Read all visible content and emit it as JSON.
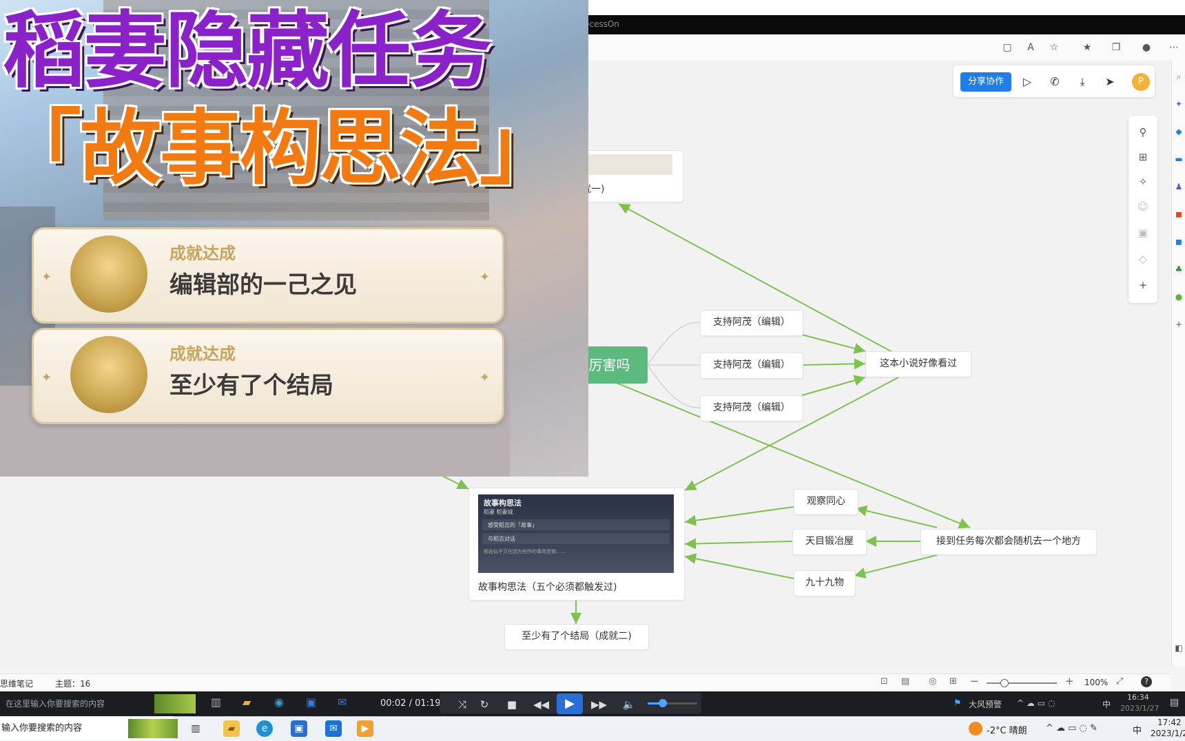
{
  "browser": {
    "tab_title": "ocessOn"
  },
  "share_toolbar": {
    "share_label": "分享协作",
    "avatar_letter": "P"
  },
  "mindmap": {
    "root": "这本小说...厉害吗",
    "top_node_caption": "就一)",
    "support_nodes": [
      "支持阿茂（编辑）",
      "支持阿茂（编辑）",
      "支持阿茂（编辑）"
    ],
    "right_node": "这本小说好像看过",
    "image_node": {
      "card_title": "故事构思法",
      "card_sub": "稻妻 稻妻城",
      "card_items": [
        "感受稻吉的「故事」",
        "与稻吉对话"
      ],
      "card_note": "稻吉似乎又在因为创作的事而苦恼……",
      "caption": "故事构思法（五个必须都触发过)"
    },
    "location_nodes": [
      "观察同心",
      "天目锻冶屋",
      "九十九物"
    ],
    "trigger_node": "接到任务每次都会随机去一个地方",
    "ending_node": "至少有了个结局（成就二)"
  },
  "overlay": {
    "title_line1": "稻妻隐藏任务",
    "title_line2": "「故事构思法」",
    "achievements": [
      {
        "label": "成就达成",
        "name": "编辑部的一己之见"
      },
      {
        "label": "成就达成",
        "name": "至少有了个结局"
      }
    ]
  },
  "status_bar": {
    "app": "思维笔记",
    "topics": "主题：16",
    "zoom": "100%"
  },
  "player": {
    "search_placeholder": "在这里输入你要搜索的内容",
    "time": "00:02 / 01:19",
    "progress": 0.025,
    "volume": 0.3,
    "weather_alert": "大风预警",
    "tray_lang": "中",
    "clock_time": "16:34",
    "clock_date": "2023/1/27"
  },
  "taskbar": {
    "search_placeholder": "输入你要搜索的内容",
    "weather": "-2°C 晴朗",
    "lang": "中",
    "time": "17:42",
    "date": "2023/1/2"
  },
  "colors": {
    "root_green": "#5cba7e",
    "link_green": "#7cc24e",
    "share_blue": "#1f7fe6",
    "title_purple": "#8b22c9",
    "title_orange": "#f27a10"
  }
}
